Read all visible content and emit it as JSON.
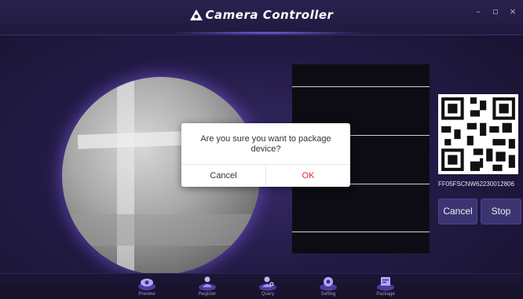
{
  "window": {
    "title": "Camera Controller",
    "controls": {
      "minimize": "–",
      "maximize": "▫",
      "close": "×"
    }
  },
  "dialog": {
    "message": "Are you sure you want to package device?",
    "cancel_label": "Cancel",
    "ok_label": "OK"
  },
  "side_panel": {
    "serial_number": "FF05FSCNW62230012806",
    "cancel_label": "Cancel",
    "stop_label": "Stop"
  },
  "nav": {
    "items": [
      {
        "label": "Preview",
        "icon": "eye-icon"
      },
      {
        "label": "Register",
        "icon": "user-icon"
      },
      {
        "label": "Query",
        "icon": "user-search-icon"
      },
      {
        "label": "Setting",
        "icon": "gear-icon"
      },
      {
        "label": "Package",
        "icon": "package-icon"
      }
    ]
  },
  "colors": {
    "accent": "#7a5cff",
    "ok_text": "#e0262e",
    "button_bg": "#3b3470"
  }
}
